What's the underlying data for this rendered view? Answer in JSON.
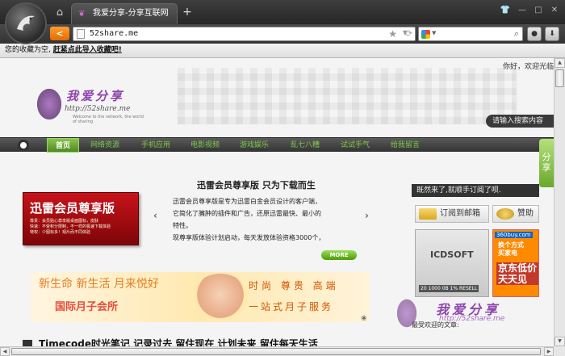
{
  "browser": {
    "tab_title": "我爱分享-分享互联网",
    "tab_favicon": "butterfly-icon",
    "new_tab": "+",
    "address": "52share.me",
    "icons": {
      "home": "home-icon",
      "back": "back-icon",
      "refresh": "refresh-icon",
      "search": "search-icon",
      "star": "star-icon"
    }
  },
  "bookmarks": {
    "empty_text": "您的收藏为空,",
    "import_link": "赶紧点此导入收藏吧!"
  },
  "page": {
    "greeting": "你好，欢迎光临",
    "logo": {
      "text": "我爱分享",
      "url": "http://52share.me",
      "tagline": "Welcome to the network, the world of sharing"
    },
    "search_tip": "请输入搜索内容",
    "nav": [
      "首页",
      "网络资源",
      "手机应用",
      "电影视频",
      "游戏娱乐",
      "乱七八糟",
      "试试手气",
      "给我留言"
    ],
    "featured": {
      "headline": "迅雷会员尊享版 只为下载而生",
      "banner_title": "迅雷会员尊享版",
      "banner_lines": [
        "尊贵：会员贴心尊享版桌面图标，皮肤",
        "快速：不受积分限制，不一样的极速下载体验",
        "特权：少图标多！观片而不同体验"
      ],
      "description": [
        "迅雷会员尊享版是专为迅雷白金会员设计的客户端，",
        "它简化了臃肿的插件和广告，还原迅雷最快、最小的",
        "特性。",
        "现尊享版体验计划启动，每天发放体验资格3000个，"
      ],
      "more": "MORE"
    },
    "promo": {
      "left1": "新生命 新生活 月来悦好",
      "left2": "国际月子会所",
      "right1": "时尚 尊贵 高端",
      "right2": "一站式月子服务"
    },
    "bottom_title": "Timecode时光笔记 记录过去 留住现在 计划未来 留住每天生活",
    "sidebar": {
      "subscribe_bar": "既然来了,就顺手订阅了呗.",
      "subscribe_btn": "订阅到邮箱",
      "donate_btn": "赞助",
      "share_tab": "分享",
      "ad1_title": "ICDSOFT",
      "ad1_sub": "20 1000 0B 1% RESELL",
      "ad2_badge": "360buy.com",
      "ad2_line1": "换个方式",
      "ad2_line2": "买家电",
      "ad2_line3": "京东低价",
      "ad2_line4": "天天见",
      "welcome": "最受欢迎的文章:",
      "watermark_text": "我爱分享",
      "watermark_url": "http://52share.me"
    }
  }
}
